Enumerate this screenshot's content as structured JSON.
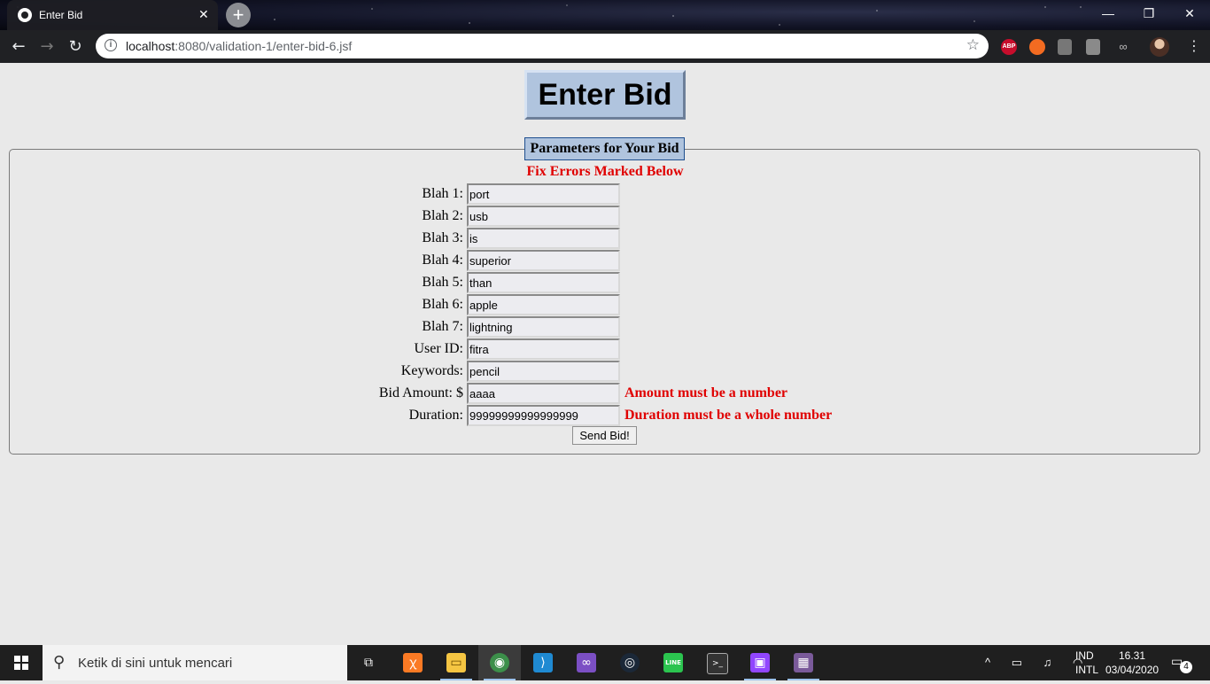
{
  "browser": {
    "tab_title": "Enter Bid",
    "tab_close": "✕",
    "new_tab": "+",
    "url_host": "localhost",
    "url_path": ":8080/validation-1/enter-bid-6.jsf",
    "back": "←",
    "forward": "→",
    "reload": "↻",
    "window_buttons": {
      "minimize": "—",
      "maximize": "❐",
      "close": "✕"
    },
    "extensions": [
      "ABP",
      "",
      "",
      "",
      "∞"
    ]
  },
  "page": {
    "heading": "Enter Bid",
    "legend": "Parameters for Your Bid",
    "error_summary": "Fix Errors Marked Below",
    "fields": [
      {
        "label": "Blah 1:",
        "value": "port",
        "error": ""
      },
      {
        "label": "Blah 2:",
        "value": "usb",
        "error": ""
      },
      {
        "label": "Blah 3:",
        "value": "is",
        "error": ""
      },
      {
        "label": "Blah 4:",
        "value": "superior",
        "error": ""
      },
      {
        "label": "Blah 5:",
        "value": "than",
        "error": ""
      },
      {
        "label": "Blah 6:",
        "value": "apple",
        "error": ""
      },
      {
        "label": "Blah 7:",
        "value": "lightning",
        "error": ""
      },
      {
        "label": "User ID:",
        "value": "fitra",
        "error": ""
      },
      {
        "label": "Keywords:",
        "value": "pencil",
        "error": ""
      },
      {
        "label": "Bid Amount: $",
        "value": "aaaa",
        "error": "Amount must be a number"
      },
      {
        "label": "Duration:",
        "value": "99999999999999999",
        "error": "Duration must be a whole number"
      }
    ],
    "submit_label": "Send Bid!",
    "colors": {
      "error": "#e00000",
      "title_bg": "#b0c4de",
      "page_bg": "#e9e9e9"
    }
  },
  "taskbar": {
    "search_placeholder": "Ketik di sini untuk mencari",
    "apps": [
      {
        "name": "task-view",
        "glyph": "⧉",
        "color": "#1f1f1f"
      },
      {
        "name": "xampp",
        "glyph": "ꭓ",
        "color": "#fb7a24"
      },
      {
        "name": "file-explorer",
        "glyph": "▭",
        "color": "#f5c542"
      },
      {
        "name": "chrome",
        "glyph": "◉",
        "color": "#3c8f4a"
      },
      {
        "name": "vscode",
        "glyph": "⟩",
        "color": "#1f8ad2"
      },
      {
        "name": "visual-studio",
        "glyph": "∞",
        "color": "#7b4fc4"
      },
      {
        "name": "steam",
        "glyph": "◎",
        "color": "#1b2838"
      },
      {
        "name": "line",
        "glyph": "LINE",
        "color": "#2bc44f"
      },
      {
        "name": "terminal",
        "glyph": ">_",
        "color": "#333333"
      },
      {
        "name": "twitch",
        "glyph": "▣",
        "color": "#9146ff"
      },
      {
        "name": "game",
        "glyph": "▦",
        "color": "#7a5a9a"
      }
    ],
    "tray_icons": "^ ▭ ♫ ◠",
    "language_top": "IND",
    "language_bottom": "INTL",
    "time": "16.31",
    "date": "03/04/2020",
    "notification_count": "4"
  }
}
